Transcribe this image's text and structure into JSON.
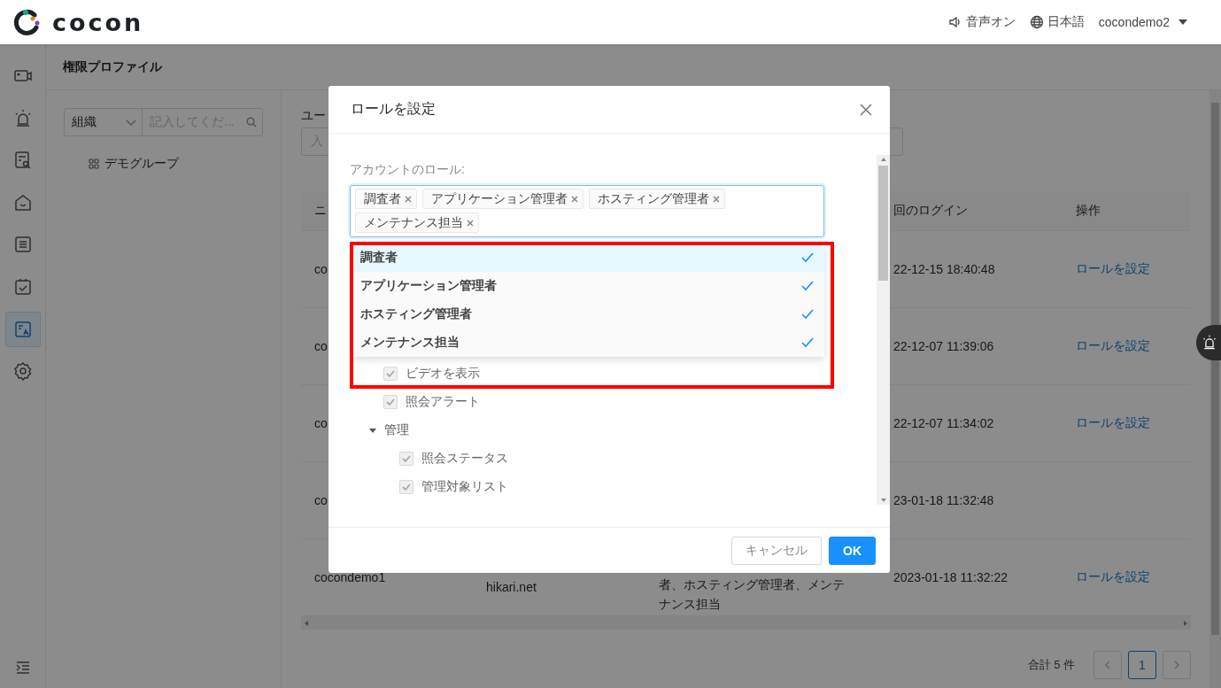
{
  "header": {
    "logo_text": "cocon",
    "sound": "音声オン",
    "language": "日本語",
    "user": "cocondemo2"
  },
  "nav_items": [
    {
      "selected": false
    },
    {
      "selected": false
    },
    {
      "selected": false
    },
    {
      "selected": false
    },
    {
      "selected": false
    },
    {
      "selected": false
    },
    {
      "selected": true
    },
    {
      "selected": false
    }
  ],
  "page_title": "権限プロファイル",
  "org_filter": {
    "value": "組織",
    "placeholder": "記入してくだ..."
  },
  "org_tree": [
    {
      "label": "デモグループ"
    }
  ],
  "user_field": {
    "label": "ユー",
    "placeholder": "入"
  },
  "table": {
    "header": {
      "name": "ニ",
      "last_login": "回のログイン",
      "action": "操作"
    },
    "rows": [
      {
        "name": "co",
        "last_login": "22-12-15 18:40:48",
        "action": "ロールを設定"
      },
      {
        "name": "co",
        "last_login": "22-12-07 11:39:06",
        "action": "ロールを設定"
      },
      {
        "name": "co",
        "last_login": "22-12-07 11:34:02",
        "action": "ロールを設定"
      },
      {
        "name": "co",
        "last_login": "23-01-18 11:32:48"
      },
      {
        "name": "cocondemo1",
        "email": "hikari.net",
        "roles": "者、ホスティング管理者、メンテナンス担当",
        "last_login": "2023-01-18 11:32:22",
        "action": "ロールを設定"
      }
    ]
  },
  "pagination": {
    "total": "合計 5 件",
    "pages": [
      {
        "label": "1",
        "selected": true
      }
    ]
  },
  "modal": {
    "title": "ロールを設定",
    "field_label": "アカウントのロール:",
    "tags": [
      {
        "label": "調査者"
      },
      {
        "label": "アプリケーション管理者"
      },
      {
        "label": "ホスティング管理者"
      },
      {
        "label": "メンテナンス担当"
      }
    ],
    "options": [
      {
        "label": "調査者",
        "selected": true,
        "active": true
      },
      {
        "label": "アプリケーション管理者",
        "selected": true,
        "active": false
      },
      {
        "label": "ホスティング管理者",
        "selected": true,
        "active": false
      },
      {
        "label": "メンテナンス担当",
        "selected": true,
        "active": false
      }
    ],
    "tree": [
      {
        "label": "ビデオを表示",
        "checked": true,
        "disabled": true
      },
      {
        "label": "照会アラート",
        "checked": true,
        "disabled": true
      },
      {
        "label": "管理",
        "expanded": true,
        "children": [
          {
            "label": "照会ステータス",
            "checked": true,
            "disabled": true
          },
          {
            "label": "管理対象リスト",
            "checked": true,
            "disabled": true
          }
        ]
      }
    ],
    "buttons": [
      {
        "label": "キャンセル",
        "kind": "default"
      },
      {
        "label": "OK",
        "kind": "primary"
      }
    ]
  }
}
